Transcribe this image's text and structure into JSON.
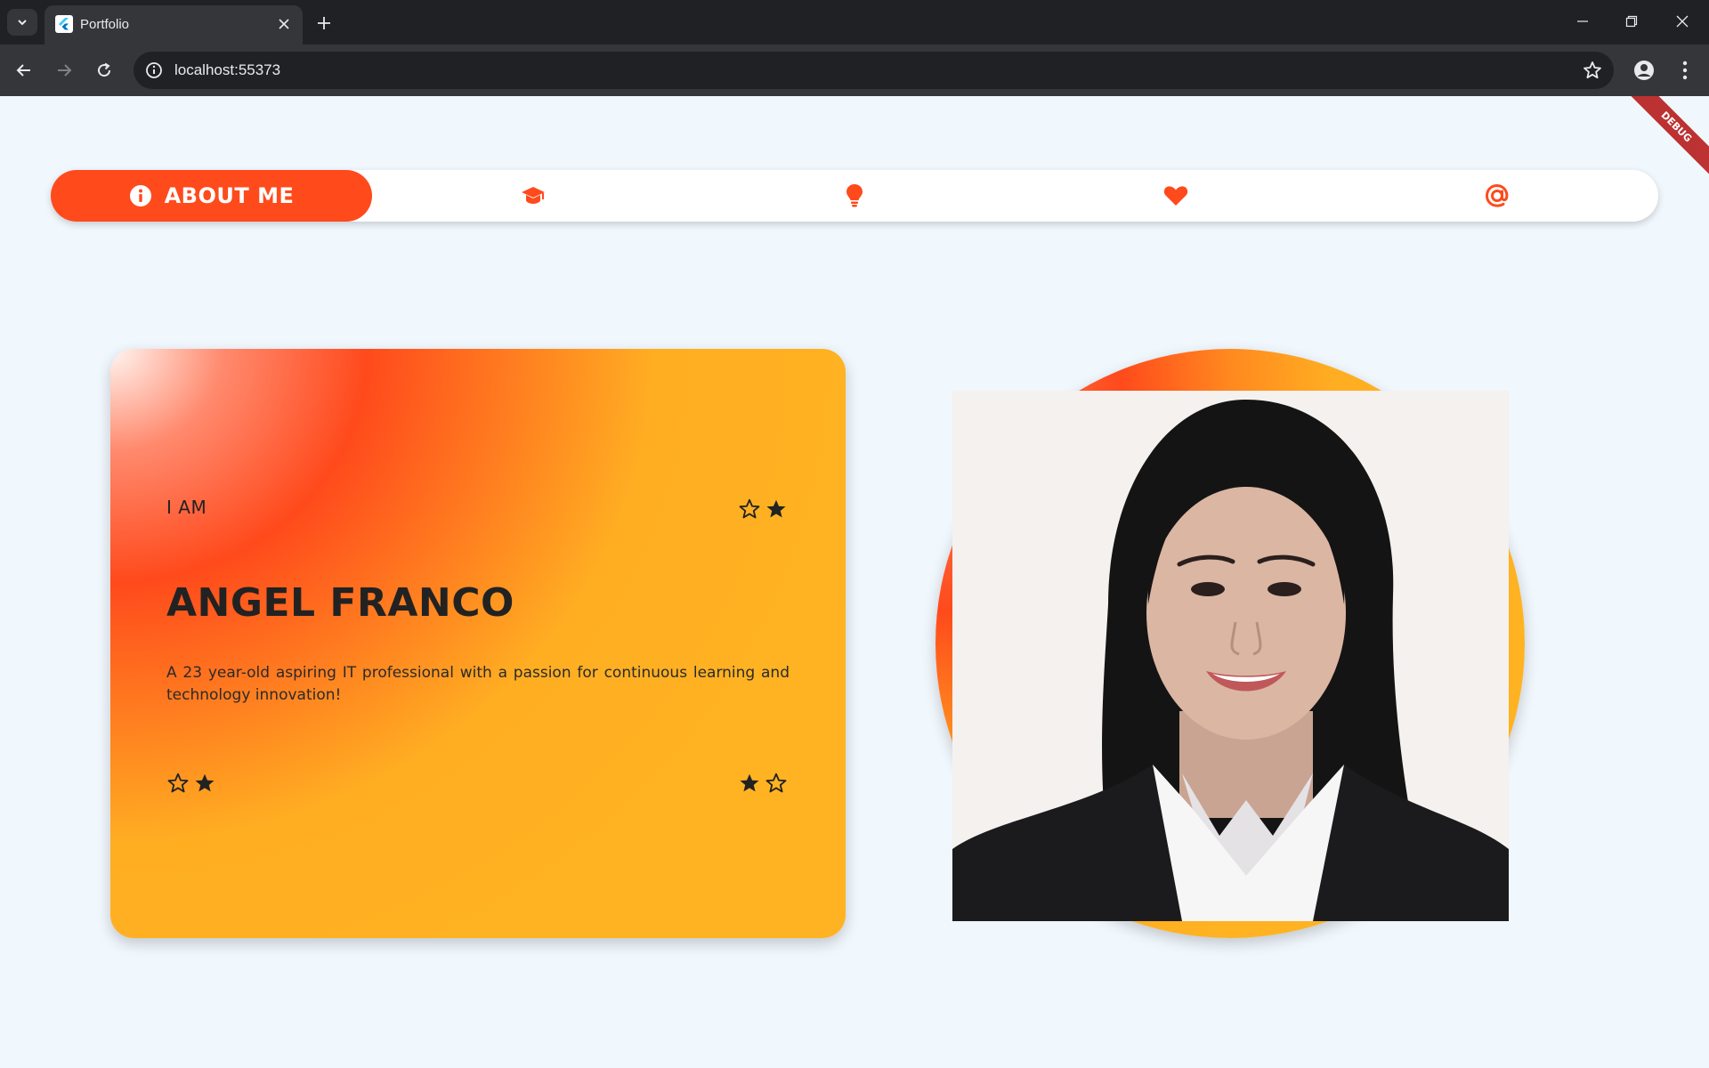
{
  "browser": {
    "tab_title": "Portfolio",
    "url": "localhost:55373"
  },
  "debug_banner": "DEBUG",
  "nav": {
    "active_label": "ABOUT ME",
    "active_icon": "info-icon",
    "items": [
      {
        "icon": "graduation-cap-icon"
      },
      {
        "icon": "lightbulb-icon"
      },
      {
        "icon": "heart-icon"
      },
      {
        "icon": "at-sign-icon"
      }
    ]
  },
  "card": {
    "label": "I AM",
    "name": "ANGEL FRANCO",
    "description": "A 23 year-old aspiring IT professional with a passion for continuous learning and technology innovation!"
  },
  "colors": {
    "accent": "#ff4a1c",
    "accent_orange": "#ffb322",
    "page_bg": "#f0f7fd"
  }
}
